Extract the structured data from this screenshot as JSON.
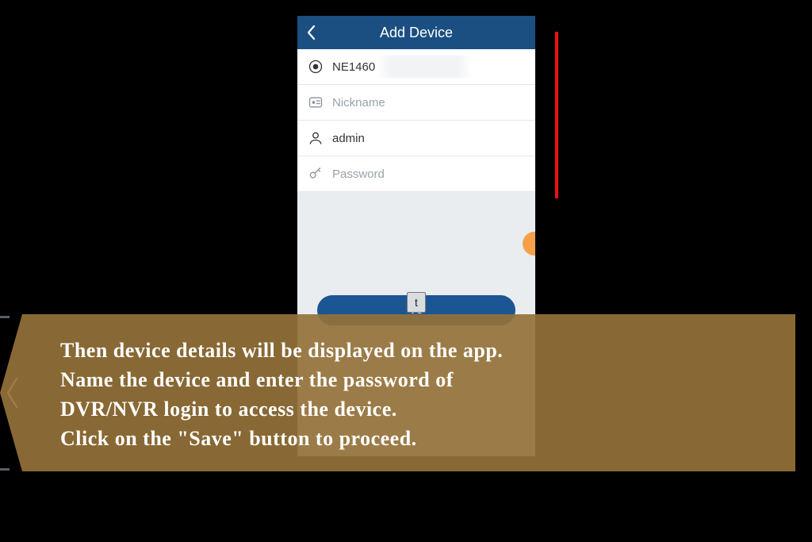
{
  "header": {
    "title": "Add Device"
  },
  "form": {
    "device_id": "NE1460",
    "nickname_placeholder": "Nickname",
    "username": "admin",
    "password_placeholder": "Password"
  },
  "save_button": {
    "label_visible": "ve",
    "cursor_char": "t"
  },
  "caption": {
    "line1": "Then device details will be displayed on the app.",
    "line2": "Name the device and enter the password of",
    "line3": "DVR/NVR login to access the device.",
    "line4": "Click on the \"Save\" button to proceed."
  }
}
